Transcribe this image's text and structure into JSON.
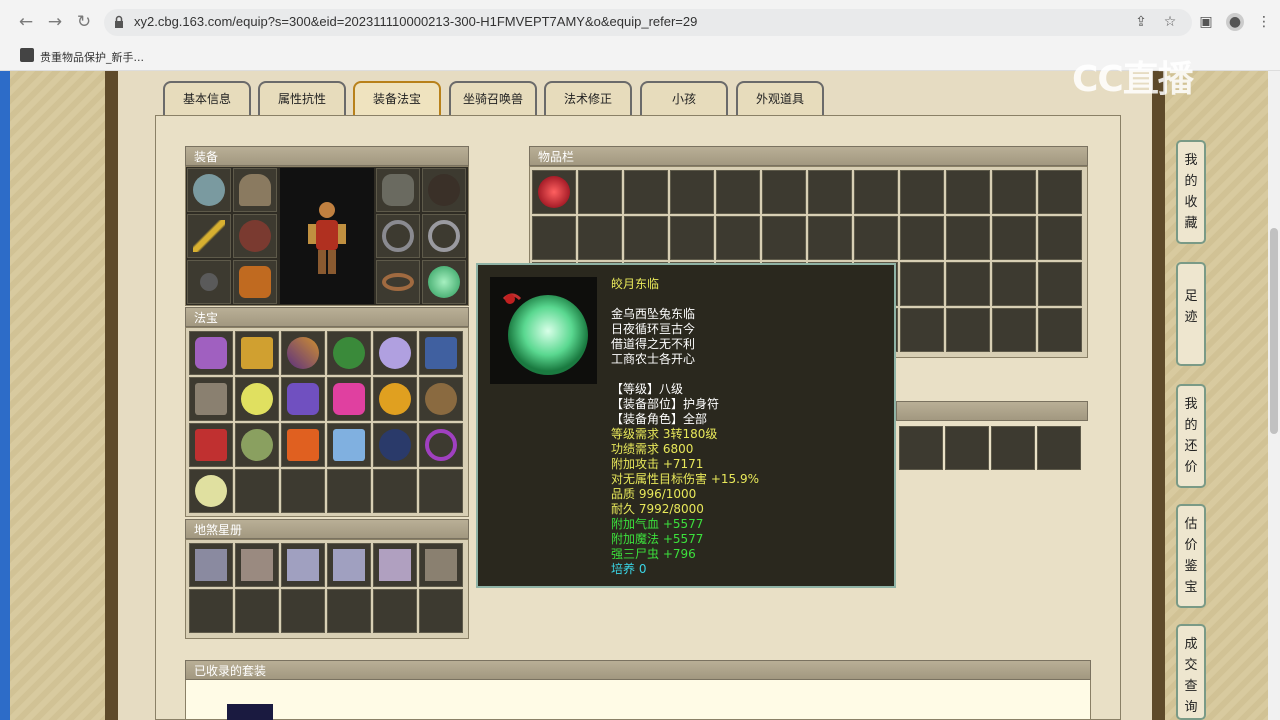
{
  "browser": {
    "url": "xy2.cbg.163.com/equip?s=300&eid=202311110000213-300-H1FMVEPT7AMY&o&equip_refer=29",
    "bookmark": "贵重物品保护_新手..."
  },
  "watermark": "CC直播",
  "tabs": [
    "基本信息",
    "属性抗性",
    "装备法宝",
    "坐骑召唤兽",
    "法术修正",
    "小孩",
    "外观道具"
  ],
  "sections": {
    "equipment": "装备",
    "fabao": "法宝",
    "dishaxing": "地煞星册",
    "inventory": "物品栏",
    "suits": "已收录的套装"
  },
  "tooltip": {
    "name": "皎月东临",
    "desc": [
      "金乌西坠兔东临",
      "日夜循环亘古今",
      "借道得之无不利",
      "工商农士各开心"
    ],
    "level": "【等级】八级",
    "slot": "【装备部位】护身符",
    "role": "【装备角色】全部",
    "stats": [
      {
        "text": "等级需求 3转180级",
        "color": "#e8e85a"
      },
      {
        "text": "功绩需求 6800",
        "color": "#e8e85a"
      },
      {
        "text": "附加攻击 +7171",
        "color": "#e8e85a"
      },
      {
        "text": "对无属性目标伤害 +15.9%",
        "color": "#e8e85a"
      },
      {
        "text": "品质 996/1000",
        "color": "#e8e85a"
      },
      {
        "text": "耐久 7992/8000",
        "color": "#e8e85a"
      },
      {
        "text": "附加气血 +5577",
        "color": "#3ce03c"
      },
      {
        "text": "附加魔法 +5577",
        "color": "#3ce03c"
      },
      {
        "text": "强三尸虫 +796",
        "color": "#3ce03c"
      },
      {
        "text": "培养 0",
        "color": "#3ad6e6"
      }
    ]
  },
  "side_nav": [
    "我的收藏",
    "足迹",
    "我的还价",
    "估价鉴宝",
    "成交查询"
  ],
  "colors": {
    "accent_tab": "#b8811a",
    "tooltip_border": "#8fb3a6"
  }
}
